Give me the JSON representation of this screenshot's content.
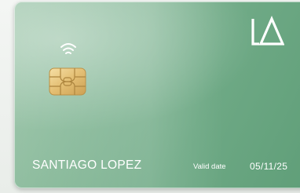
{
  "card": {
    "brand": {
      "logo_icon": "la-monogram-logo",
      "logo_color": "#ffffff"
    },
    "contactless_icon": "contactless-wifi-icon",
    "chip_icon": "emv-chip-icon",
    "holder_name": "SANTIAGO LOPEZ",
    "valid_label": "Valid date",
    "valid_value": "05/11/25",
    "colors": {
      "card_start": "#a6cbb2",
      "card_end": "#5f9e78",
      "text": "#ffffff",
      "chip_gold": "#e8c47a"
    }
  }
}
